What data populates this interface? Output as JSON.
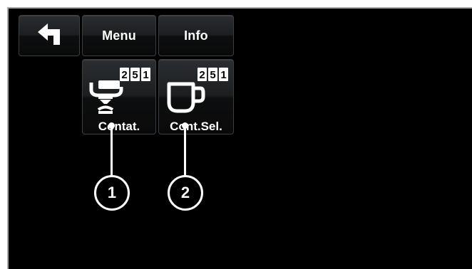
{
  "toolbar": {
    "back_icon": "back-arrow-icon",
    "menu_label": "Menu",
    "info_label": "Info"
  },
  "counters": [
    {
      "label": "Contat.",
      "icon": "brew-group-counter-icon",
      "digits": [
        "2",
        "5",
        "1"
      ]
    },
    {
      "label": "Cont.Sel.",
      "icon": "cup-counter-icon",
      "digits": [
        "2",
        "5",
        "1"
      ]
    }
  ],
  "callouts": [
    "1",
    "2"
  ],
  "colors": {
    "screen_background": "#000000",
    "button_text": "#ffffff",
    "button_border": "#3c3f42"
  }
}
